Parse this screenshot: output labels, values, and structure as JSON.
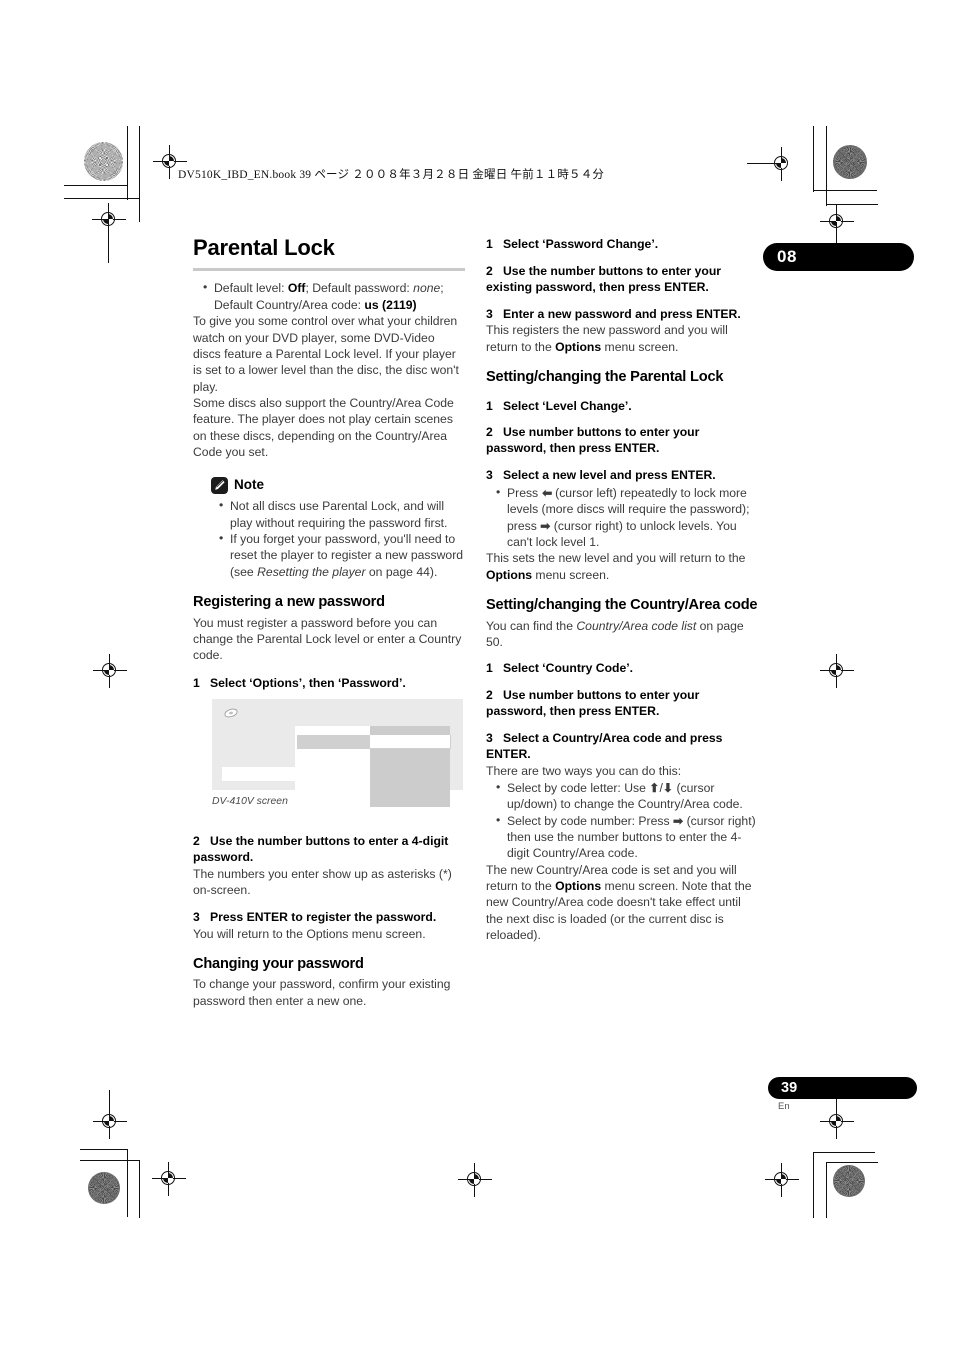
{
  "print_header": {
    "text": "DV510K_IBD_EN.book  39 ページ  ２００８年３月２８日  金曜日  午前１１時５４分"
  },
  "chapter_badge": {
    "number": "08"
  },
  "page_footer": {
    "number": "39",
    "language": "En"
  },
  "left_column": {
    "title": "Parental Lock",
    "intro_bullet": {
      "prefix": "Default level: ",
      "default_level": "Off",
      "mid": "; Default password: ",
      "default_password": "none",
      "suffix": "; Default Country/Area code: ",
      "default_country_code": "us (2119)"
    },
    "intro_paragraph_1": "To give you some control over what your children watch on your DVD player, some DVD-Video discs feature a Parental Lock level. If your player is set to a lower level than the disc, the disc won't play.",
    "intro_paragraph_2": "Some discs also support the Country/Area Code feature. The player does not play certain scenes on these discs, depending on the Country/Area Code you set.",
    "note": {
      "label": "Note",
      "icon": "pencil-icon",
      "items": [
        "Not all discs use Parental Lock, and will play without requiring the password first."
      ],
      "item2_prefix": "If you forget your password, you'll need to reset the player to register a new password (see ",
      "item2_italic": "Resetting the player",
      "item2_suffix": " on page 44)."
    },
    "section_registering": {
      "heading": "Registering a new password",
      "body": "You must register a password before you can change the Parental Lock level or enter a Country code.",
      "step1_num": "1",
      "step1_text": "Select ‘Options’, then ‘Password’.",
      "figure_caption": "DV-410V screen",
      "step2_num": "2",
      "step2_text": "Use the number buttons to enter a 4-digit password.",
      "step2_body": "The numbers you enter show up as asterisks (*) on-screen.",
      "step3_num": "3",
      "step3_text": "Press ENTER to register the password.",
      "step3_body": "You will return to the Options menu screen."
    },
    "section_changing": {
      "heading": "Changing your password",
      "body": "To change your password, confirm your existing password then enter a new one."
    }
  },
  "right_column": {
    "section_changing_continued": {
      "step1_num": "1",
      "step1_text": "Select ‘Password Change’.",
      "step2_num": "2",
      "step2_text": "Use the number buttons to enter your existing password, then press ENTER.",
      "step3_num": "3",
      "step3_text": "Enter a new password and press ENTER.",
      "step3_body_prefix": "This registers the new password and you will return to the ",
      "step3_body_bold": "Options",
      "step3_body_suffix": " menu screen."
    },
    "section_parental_lock": {
      "heading": "Setting/changing the Parental Lock",
      "step1_num": "1",
      "step1_text": "Select ‘Level Change’.",
      "step2_num": "2",
      "step2_text": "Use number buttons to enter your password, then press ENTER.",
      "step3_num": "3",
      "step3_text": "Select a new level and press ENTER.",
      "bullet_part1": "Press ",
      "bullet_arrow_left": "➡",
      "bullet_part2": " (cursor left) repeatedly to lock more levels (more discs will require the password); press ",
      "bullet_arrow_right": "➡",
      "bullet_part3": " (cursor right) to unlock levels. You can't lock level 1.",
      "body_prefix": "This sets the new level and you will return to the ",
      "body_bold": "Options",
      "body_suffix": " menu screen."
    },
    "section_country_code": {
      "heading": "Setting/changing the Country/Area code",
      "body_prefix": "You can find the ",
      "body_italic": "Country/Area code list",
      "body_suffix": " on page 50.",
      "step1_num": "1",
      "step1_text": "Select ‘Country Code’.",
      "step2_num": "2",
      "step2_text": "Use number buttons to enter your password, then press ENTER.",
      "step3_num": "3",
      "step3_text": "Select a Country/Area code and press ENTER.",
      "step3_body": "There are two ways you can do this:",
      "bullet1_prefix": "Select by code letter: Use ",
      "bullet1_arrow_up": "⬆",
      "bullet1_slash": "/",
      "bullet1_arrow_down": "⬇",
      "bullet1_suffix": " (cursor up/down) to change the Country/Area code.",
      "bullet2_prefix": "Select by code number: Press ",
      "bullet2_arrow_right": "➡",
      "bullet2_suffix": " (cursor right) then use the number buttons to enter the 4-digit Country/Area code.",
      "closing_prefix": "The new Country/Area code is set and you will return to the ",
      "closing_bold": "Options",
      "closing_suffix": " menu screen. Note that the new Country/Area code doesn't take effect until the next disc is loaded (or the current disc is reloaded)."
    }
  },
  "colors": {
    "accent_black": "#000000",
    "body_text": "#3b3b3b",
    "rule_grey": "#c9c9c9",
    "screenshot_bg": "#eaeaea"
  }
}
